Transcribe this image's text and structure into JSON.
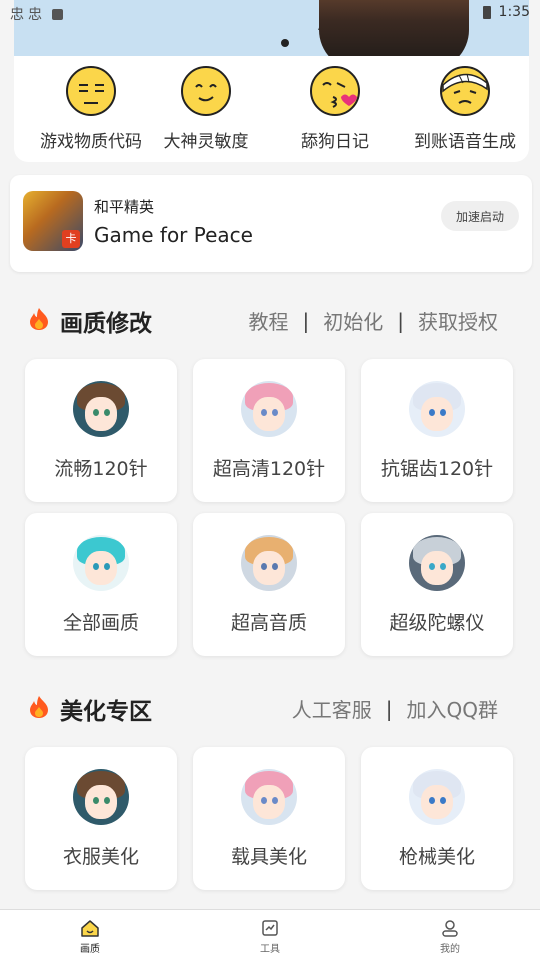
{
  "status_bar": {
    "time": "1:35",
    "notif_glyphs": [
      "忠",
      "忠"
    ]
  },
  "quick_actions": [
    {
      "label": "游戏物质代码",
      "icon": "neutral-face-icon"
    },
    {
      "label": "大神灵敏度",
      "icon": "smiling-face-icon"
    },
    {
      "label": "舔狗日记",
      "icon": "kissing-face-icon"
    },
    {
      "label": "到账语音生成",
      "icon": "bandaged-face-icon"
    }
  ],
  "game_card": {
    "name": "和平精英",
    "subtitle": "Game for Peace",
    "launch_label": "加速启动",
    "icon_tag": "卡"
  },
  "section_quality": {
    "title": "画质修改",
    "links": [
      "教程",
      "初始化",
      "获取授权"
    ],
    "separator": "|",
    "tiles": [
      "流畅120针",
      "超高清120针",
      "抗锯齿120针",
      "全部画质",
      "超高音质",
      "超级陀螺仪"
    ]
  },
  "section_beautify": {
    "title": "美化专区",
    "links": [
      "人工客服",
      "加入QQ群"
    ],
    "separator": "|",
    "tiles": [
      "衣服美化",
      "载具美化",
      "枪械美化"
    ]
  },
  "bottom_nav": [
    {
      "label": "画质",
      "icon": "home-icon",
      "active": true
    },
    {
      "label": "工具",
      "icon": "tools-icon",
      "active": false
    },
    {
      "label": "我的",
      "icon": "profile-icon",
      "active": false
    }
  ],
  "colors": {
    "accent_flame": "#ff5a1f",
    "emoji_yellow": "#fbd64a",
    "background": "#f4f4f4"
  }
}
